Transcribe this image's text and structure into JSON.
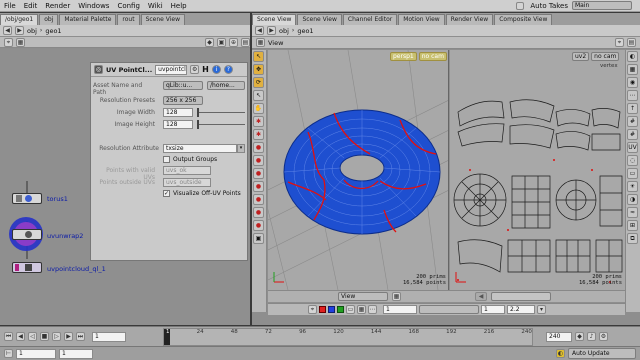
{
  "menubar": {
    "items": [
      "File",
      "Edit",
      "Render",
      "Windows",
      "Config",
      "Wiki",
      "Help"
    ],
    "auto_takes": "Auto Takes",
    "desktop": "Main"
  },
  "left_tabs": [
    "/obj/geo1",
    "obj",
    "Material Palette",
    "rout",
    "Scene View"
  ],
  "right_tabs": [
    "Scene View",
    "Scene View",
    "Channel Editor",
    "Motion View",
    "Render View",
    "Composite View"
  ],
  "left_path": {
    "obj": "obj",
    "node": "geo1"
  },
  "right_path": {
    "obj": "obj",
    "node": "geo1"
  },
  "params": {
    "title": "UV PointCl...",
    "node_name": "uvpointcl",
    "asset_label": "Asset Name and Path",
    "asset_lib": "qLib::u...",
    "asset_path": "/home...",
    "presets_label": "Resolution Presets",
    "presets_value": "256 x 256",
    "width_label": "Image Width",
    "width_value": "128",
    "height_label": "Image Height",
    "height_value": "128",
    "attr_label": "Resolution Attribute",
    "attr_value": "txsize",
    "output_groups": "Output Groups",
    "valid_uvs_label": "Points with valid UVs",
    "valid_uvs_value": "uvs_ok",
    "outside_uvs_label": "Points outside UVs",
    "outside_uvs_value": "uvs_outside",
    "visualize": "Visualize Off-UV Points"
  },
  "nodes": [
    {
      "name": "torus1"
    },
    {
      "name": "uvunwrap2"
    },
    {
      "name": "uvpointcloud_ql_1"
    }
  ],
  "viewport": {
    "label": "View",
    "persp_left": [
      "persp1",
      "no cam"
    ],
    "persp_right": [
      "uv2",
      "no cam"
    ],
    "vertex_label": "vertex",
    "left_prims": "200  prims",
    "left_points": "16,584 points",
    "right_prims": "200  prims",
    "right_points": "16,584 points",
    "view_menu": "View",
    "frame_field": "1",
    "step_field": "1",
    "value_field": "2.2"
  },
  "timeline": {
    "frame": "1",
    "start": "1",
    "end": "240",
    "ticks": [
      "1",
      "24",
      "48",
      "72",
      "96",
      "120",
      "144",
      "168",
      "192",
      "216",
      "240"
    ],
    "auto_update": "Auto Update"
  },
  "colors": {
    "torus_blue": "#1e4fd0",
    "seam_red": "#e01010",
    "node_blue": "#2030d0",
    "node_purple": "#7a2ec0"
  }
}
